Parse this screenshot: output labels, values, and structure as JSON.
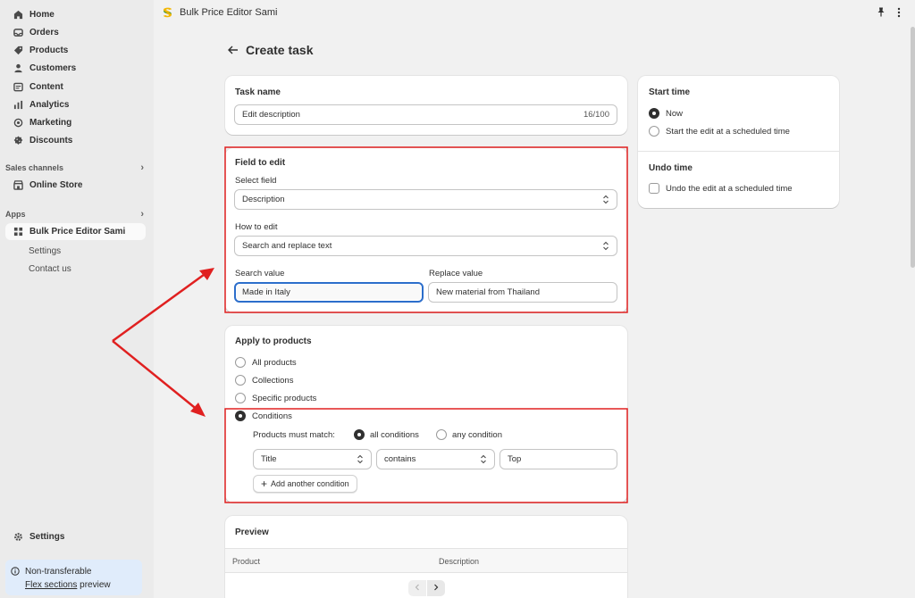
{
  "sidebar": {
    "nav": [
      {
        "label": "Home",
        "icon": "home-icon"
      },
      {
        "label": "Orders",
        "icon": "orders-icon"
      },
      {
        "label": "Products",
        "icon": "tag-icon"
      },
      {
        "label": "Customers",
        "icon": "person-icon"
      },
      {
        "label": "Content",
        "icon": "content-icon"
      },
      {
        "label": "Analytics",
        "icon": "chart-icon"
      },
      {
        "label": "Marketing",
        "icon": "target-icon"
      },
      {
        "label": "Discounts",
        "icon": "discount-icon"
      }
    ],
    "sales_channels_label": "Sales channels",
    "online_store": "Online Store",
    "apps_label": "Apps",
    "app_name": "Bulk Price Editor Sami",
    "app_sub": [
      "Settings",
      "Contact us"
    ],
    "settings": "Settings",
    "notice": {
      "title": "Non-transferable",
      "link": "Flex sections",
      "suffix": " preview"
    }
  },
  "topbar": {
    "app_title": "Bulk Price Editor Sami"
  },
  "page": {
    "title": "Create task"
  },
  "task_name": {
    "title": "Task name",
    "value": "Edit description",
    "count": "16/100"
  },
  "field_to_edit": {
    "title": "Field to edit",
    "select_label": "Select field",
    "select_value": "Description",
    "how_label": "How to edit",
    "how_value": "Search and replace text",
    "search_label": "Search value",
    "search_value": "Made in Italy",
    "replace_label": "Replace value",
    "replace_value": "New material from Thailand"
  },
  "apply": {
    "title": "Apply to products",
    "options": [
      "All products",
      "Collections",
      "Specific products",
      "Conditions"
    ],
    "selected": "Conditions",
    "match_label": "Products must match:",
    "match_all": "all conditions",
    "match_any": "any condition",
    "condition": {
      "field": "Title",
      "operator": "contains",
      "value": "Top"
    },
    "add_condition": "Add another condition"
  },
  "start_time": {
    "title": "Start time",
    "now": "Now",
    "scheduled": "Start the edit at a scheduled time"
  },
  "undo_time": {
    "title": "Undo time",
    "scheduled": "Undo the edit at a scheduled time"
  },
  "preview": {
    "title": "Preview",
    "columns": [
      "Product",
      "Description"
    ]
  },
  "colors": {
    "highlight": "#e02020",
    "focus": "#2c6ecb",
    "notice_bg": "#e0ecfb"
  }
}
